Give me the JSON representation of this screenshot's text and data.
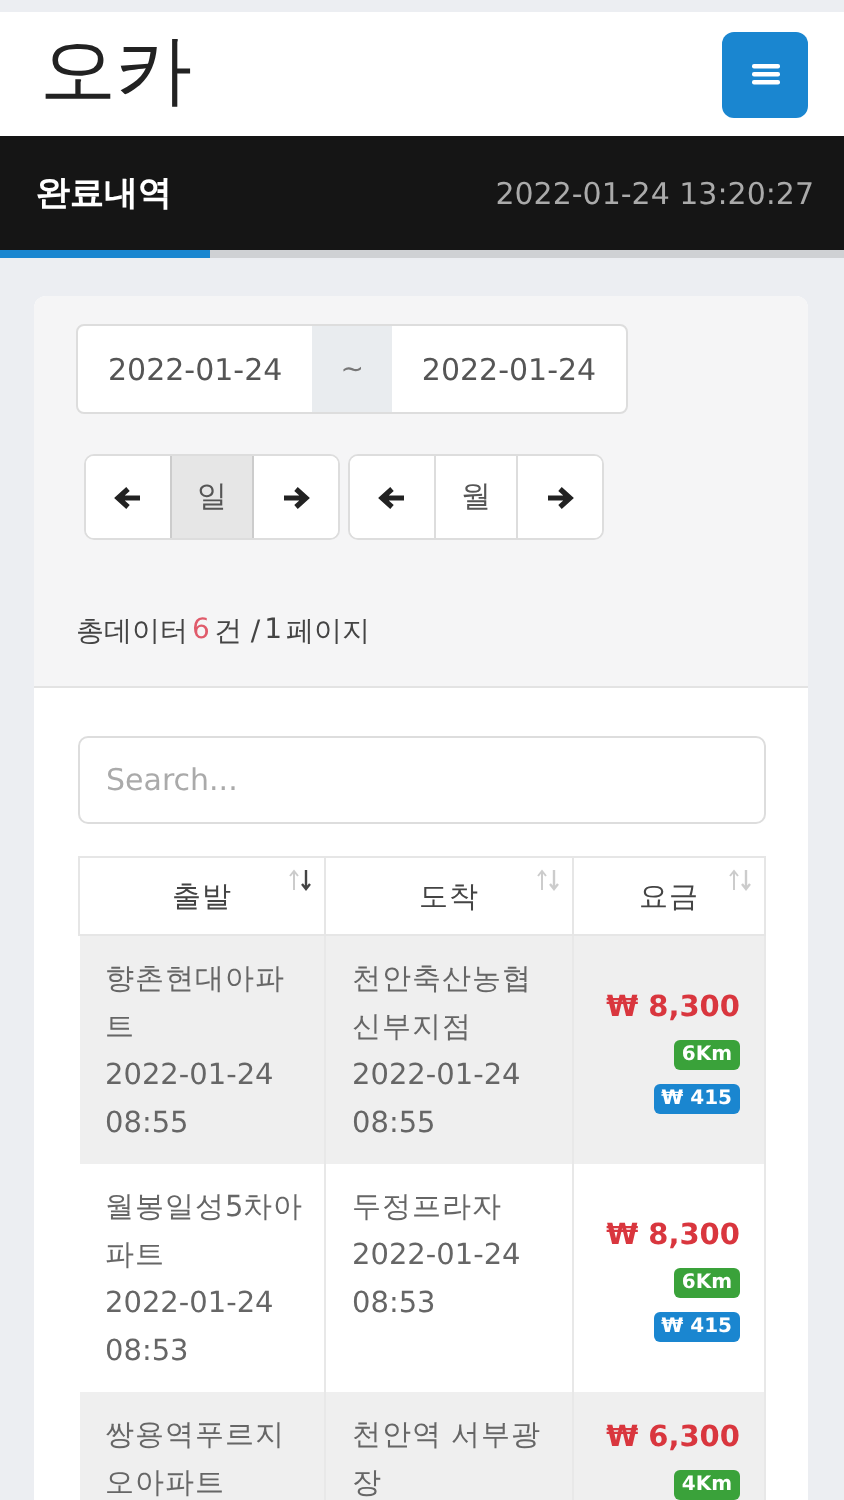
{
  "header": {
    "logo": "오카"
  },
  "title_bar": {
    "title": "완료내역",
    "datetime": "2022-01-24 13:20:27"
  },
  "date_range": {
    "from": "2022-01-24",
    "separator": "~",
    "to": "2022-01-24"
  },
  "unit_groups": [
    {
      "label": "일",
      "selected": true
    },
    {
      "label": "월",
      "selected": false
    }
  ],
  "summary": {
    "prefix": "총데이터",
    "count": "6",
    "middle": "건 / ",
    "pages": "1",
    "suffix": "페이지"
  },
  "search": {
    "placeholder": "Search..."
  },
  "table": {
    "columns": [
      {
        "label": "출발",
        "sorted": true
      },
      {
        "label": "도착",
        "sorted": false
      },
      {
        "label": "요금",
        "sorted": false
      }
    ],
    "rows": [
      {
        "start": "향촌현대아파트",
        "start_time": [
          "2022-01-24",
          "08:55"
        ],
        "end": "천안축산농협 신부지점",
        "end_time": [
          "2022-01-24",
          "08:55"
        ],
        "fare": "₩ 8,300",
        "distance": "6Km",
        "fee": "₩ 415"
      },
      {
        "start": "월봉일성5차아파트",
        "start_time": [
          "2022-01-24",
          "08:53"
        ],
        "end": "두정프라자",
        "end_time": [
          "2022-01-24",
          "08:53"
        ],
        "fare": "₩ 8,300",
        "distance": "6Km",
        "fee": "₩ 415"
      },
      {
        "start": "쌍용역푸르지오아파트",
        "start_time": [],
        "end": "천안역 서부광장",
        "end_time": [],
        "fare": "₩ 6,300",
        "distance": "4Km"
      }
    ]
  }
}
